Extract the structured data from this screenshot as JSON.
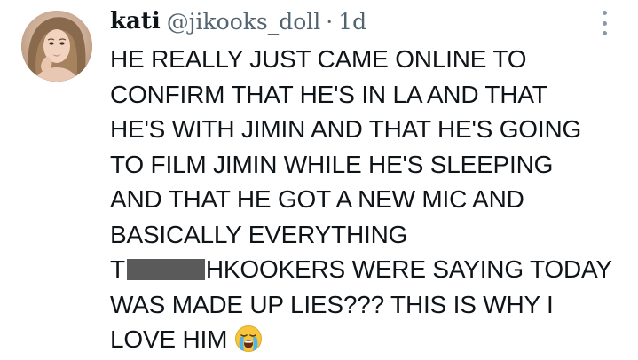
{
  "tweet": {
    "display_name": "kati",
    "handle": "@jikooks_doll",
    "separator": "·",
    "time": "1d",
    "lines": [
      "HE REALLY JUST CAME ONLINE TO",
      "CONFIRM THAT HE'S IN LA AND THAT",
      "HE'S WITH JIMIN AND THAT HE'S GOING",
      "TO FILM JIMIN WHILE HE'S SLEEPING",
      "AND THAT HE GOT A NEW MIC AND",
      "BASICALLY EVERYTHING",
      "",
      "WAS MADE UP LIES??? THIS IS WHY I",
      "LOVE HIM"
    ],
    "redacted_line": {
      "prefix": "T",
      "suffix": "HKOOKERS WERE SAYING TODAY"
    },
    "emoji": "loudly-crying-face-emoji"
  },
  "icons": {
    "more": "more-vertical-icon",
    "avatar": "profile-avatar"
  },
  "colors": {
    "text": "#0f1419",
    "secondary": "#536471",
    "redaction": "#5a5a5a",
    "background": "#ffffff"
  }
}
